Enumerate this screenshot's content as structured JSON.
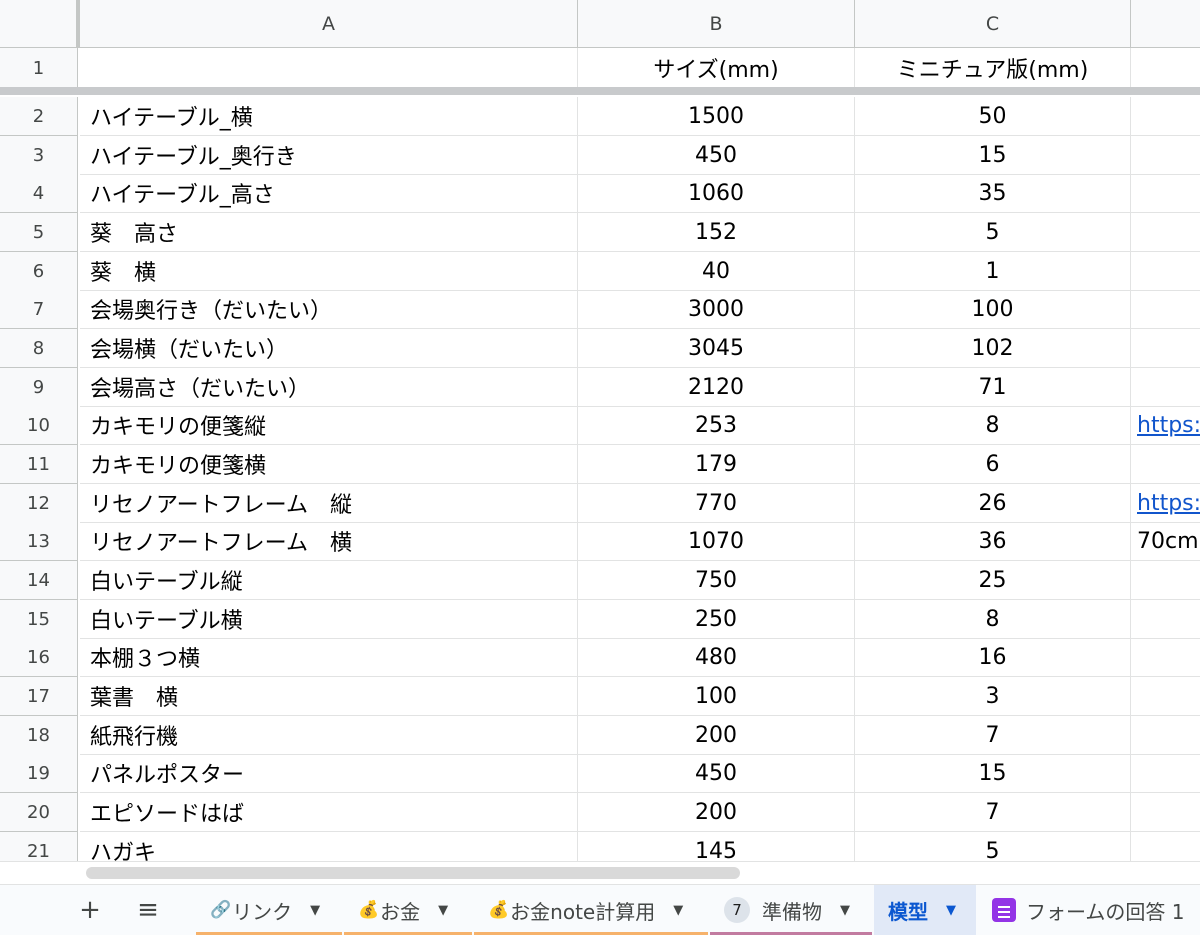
{
  "columns": [
    {
      "label": "A"
    },
    {
      "label": "B"
    },
    {
      "label": "C"
    },
    {
      "label": ""
    }
  ],
  "header_row": {
    "num": "1",
    "a": "",
    "b": "サイズ(mm)",
    "c": "ミニチュア版(mm)",
    "d": ""
  },
  "rows": [
    {
      "num": "2",
      "a": "ハイテーブル_横",
      "b": "1500",
      "c": "50",
      "d": ""
    },
    {
      "num": "3",
      "a": "ハイテーブル_奥行き",
      "b": "450",
      "c": "15",
      "d": ""
    },
    {
      "num": "4",
      "a": "ハイテーブル_高さ",
      "b": "1060",
      "c": "35",
      "d": ""
    },
    {
      "num": "5",
      "a": "葵　高さ",
      "b": "152",
      "c": "5",
      "d": ""
    },
    {
      "num": "6",
      "a": "葵　横",
      "b": "40",
      "c": "1",
      "d": ""
    },
    {
      "num": "7",
      "a": "会場奥行き（だいたい）",
      "b": "3000",
      "c": "100",
      "d": ""
    },
    {
      "num": "8",
      "a": "会場横（だいたい）",
      "b": "3045",
      "c": "102",
      "d": ""
    },
    {
      "num": "9",
      "a": "会場高さ（だいたい）",
      "b": "2120",
      "c": "71",
      "d": ""
    },
    {
      "num": "10",
      "a": "カキモリの便箋縦",
      "b": "253",
      "c": "8",
      "d": "https:/",
      "d_link": true
    },
    {
      "num": "11",
      "a": "カキモリの便箋横",
      "b": "179",
      "c": "6",
      "d": ""
    },
    {
      "num": "12",
      "a": "リセノアートフレーム　縦",
      "b": "770",
      "c": "26",
      "d": "https:/",
      "d_link": true
    },
    {
      "num": "13",
      "a": "リセノアートフレーム　横",
      "b": "1070",
      "c": "36",
      "d": "70cm"
    },
    {
      "num": "14",
      "a": "白いテーブル縦",
      "b": "750",
      "c": "25",
      "d": ""
    },
    {
      "num": "15",
      "a": "白いテーブル横",
      "b": "250",
      "c": "8",
      "d": ""
    },
    {
      "num": "16",
      "a": "本棚３つ横",
      "b": "480",
      "c": "16",
      "d": ""
    },
    {
      "num": "17",
      "a": "葉書　横",
      "b": "100",
      "c": "3",
      "d": ""
    },
    {
      "num": "18",
      "a": "紙飛行機",
      "b": "200",
      "c": "7",
      "d": ""
    },
    {
      "num": "19",
      "a": "パネルポスター",
      "b": "450",
      "c": "15",
      "d": ""
    },
    {
      "num": "20",
      "a": "エピソードはば",
      "b": "200",
      "c": "7",
      "d": ""
    },
    {
      "num": "21",
      "a": "ハガキ",
      "b": "145",
      "c": "5",
      "d": ""
    }
  ],
  "toolbar": {
    "add_sheet": "+",
    "all_sheets": "≡"
  },
  "tabs": [
    {
      "label": "リンク",
      "icon": "link-icon",
      "icon_glyph": "🔗",
      "underline": "#f6b26b",
      "active": false
    },
    {
      "label": "お金",
      "icon": "money-bag-icon",
      "icon_glyph": "💰",
      "underline": "#f6b26b",
      "active": false
    },
    {
      "label": "お金note計算用",
      "icon": "money-bag-icon",
      "icon_glyph": "💰",
      "underline": "#f6b26b",
      "active": false
    },
    {
      "label": "準備物",
      "badge": "7",
      "underline": "#c27ba0",
      "active": false
    },
    {
      "label": "模型",
      "active": true
    },
    {
      "label": "フォームの回答 1",
      "icon": "form-icon",
      "active": false
    }
  ]
}
